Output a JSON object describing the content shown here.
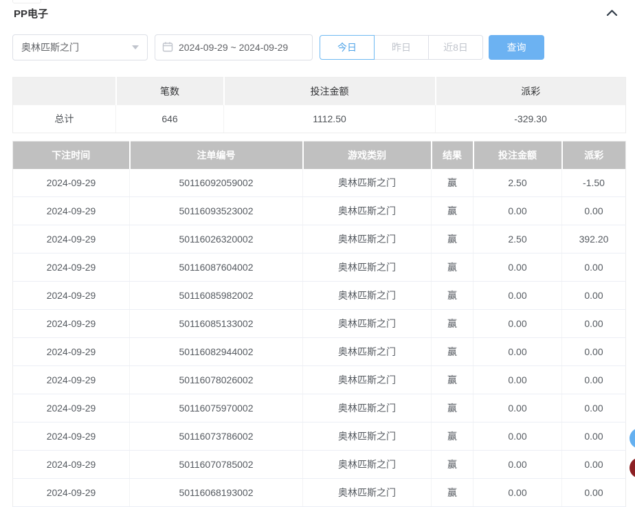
{
  "panel": {
    "title": "PP电子"
  },
  "filters": {
    "game_select": {
      "value": "奥林匹斯之门"
    },
    "date_range": {
      "value": "2024-09-29 ~ 2024-09-29"
    },
    "quick_buttons": [
      {
        "label": "今日",
        "active": true
      },
      {
        "label": "昨日",
        "active": false
      },
      {
        "label": "近8日",
        "active": false
      }
    ],
    "query_button": "查询"
  },
  "summary": {
    "headers": [
      "",
      "笔数",
      "投注金额",
      "派彩"
    ],
    "total_label": "总计",
    "count": "646",
    "bet_amount": "1112.50",
    "payout": "-329.30"
  },
  "table": {
    "headers": [
      "下注时间",
      "注单编号",
      "游戏类别",
      "结果",
      "投注金额",
      "派彩"
    ],
    "rows": [
      [
        "2024-09-29",
        "50116092059002",
        "奥林匹斯之门",
        "赢",
        "2.50",
        "-1.50"
      ],
      [
        "2024-09-29",
        "50116093523002",
        "奥林匹斯之门",
        "赢",
        "0.00",
        "0.00"
      ],
      [
        "2024-09-29",
        "50116026320002",
        "奥林匹斯之门",
        "赢",
        "2.50",
        "392.20"
      ],
      [
        "2024-09-29",
        "50116087604002",
        "奥林匹斯之门",
        "赢",
        "0.00",
        "0.00"
      ],
      [
        "2024-09-29",
        "50116085982002",
        "奥林匹斯之门",
        "赢",
        "0.00",
        "0.00"
      ],
      [
        "2024-09-29",
        "50116085133002",
        "奥林匹斯之门",
        "赢",
        "0.00",
        "0.00"
      ],
      [
        "2024-09-29",
        "50116082944002",
        "奥林匹斯之门",
        "赢",
        "0.00",
        "0.00"
      ],
      [
        "2024-09-29",
        "50116078026002",
        "奥林匹斯之门",
        "赢",
        "0.00",
        "0.00"
      ],
      [
        "2024-09-29",
        "50116075970002",
        "奥林匹斯之门",
        "赢",
        "0.00",
        "0.00"
      ],
      [
        "2024-09-29",
        "50116073786002",
        "奥林匹斯之门",
        "赢",
        "0.00",
        "0.00"
      ],
      [
        "2024-09-29",
        "50116070785002",
        "奥林匹斯之门",
        "赢",
        "0.00",
        "0.00"
      ],
      [
        "2024-09-29",
        "50116068193002",
        "奥林匹斯之门",
        "赢",
        "0.00",
        "0.00"
      ]
    ]
  },
  "colors": {
    "accent_blue": "#6cb2f2",
    "active_tab_blue": "#4ea3e8",
    "negative_red": "#f56c6c",
    "table_header_gray": "#c0c0c0",
    "summary_header_gray": "#f0f0f0",
    "float_button_blue": "#64b0f0",
    "float_button_maroon": "#8c2024"
  }
}
